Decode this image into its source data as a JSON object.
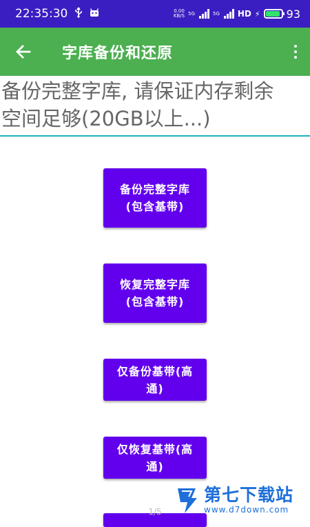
{
  "status_bar": {
    "time": "22:35:30",
    "net_speed_top": "0.00",
    "net_speed_bottom": "KB/S",
    "sim1_label": "5G",
    "sim2_label": "5G",
    "hd_label": "HD",
    "battery_level": "93",
    "battery_fraction": 0.93,
    "battery_color": "#2fe36b"
  },
  "app_bar": {
    "title": "字库备份和还原",
    "color": "#4caf50"
  },
  "notice": {
    "line1": "备份完整字库, 请保证内存剩余",
    "line2": "空间足够(20GB以上...)"
  },
  "buttons": {
    "backup_full": "备份完整字库(包含基带)",
    "restore_full": "恢复完整字库(包含基带)",
    "backup_baseband": "仅备份基带(高通)",
    "restore_baseband": "仅恢复基带(高通)"
  },
  "accent_color": "#6200ee",
  "page_indicator": "1/5",
  "watermark": {
    "name": "第七下载站",
    "url": "www.d7down.com"
  }
}
